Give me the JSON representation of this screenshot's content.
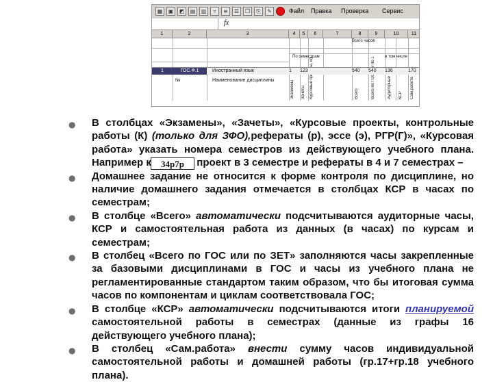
{
  "spreadsheet": {
    "menu": [
      "Файл",
      "Правка",
      "Проверка",
      "Сервис"
    ],
    "formula_label": "fx",
    "column_numbers": [
      "1",
      "2",
      "3",
      "4",
      "5",
      "6",
      "7",
      "8",
      "9",
      "10",
      "11"
    ],
    "group_headers": [
      "По семестрам",
      "Всего часов",
      "в том числе"
    ],
    "name_column_header": "Наименование дисциплины",
    "row_header": "№",
    "rotated_headers": [
      "Экзамены",
      "Зачеты",
      "Курсовые проекты, контрольные работы (К), рефераты (р), эссе (э), РГР(Г)",
      "Всего",
      "Всего по ГОС или по ЗЕТ",
      "Аудиторные",
      "КСР",
      "Сам.работа"
    ],
    "data_row": {
      "num": "1",
      "code": "ГОС.Ф.1",
      "name": "Иностранный язык",
      "exam": "1",
      "credit": "123",
      "total": "540",
      "gos": "540",
      "aud": "136",
      "sr": "170"
    }
  },
  "annotation": "34р7р",
  "bullets": [
    {
      "parts": [
        {
          "t": "В столбцах «Экзамены», «Зачеты», «Курсовые проекты, контрольные работы (К) ",
          "s": "n"
        },
        {
          "t": "(только для ЗФО),",
          "s": "i"
        },
        {
          "t": "рефераты (р), эссе (э), РГР(Г)», «Курсовая работа» указать номера семестров из действующего учебного плана. Например курсовой проект в 3 семестре и рефераты в 4 и 7 семестрах –",
          "s": "n"
        }
      ]
    },
    {
      "parts": [
        {
          "t": "Домашнее задание не относится к форме контроля по дисциплине, но наличие домашнего задания отмечается в столбцах КСР в часах по семестрам;",
          "s": "n"
        }
      ]
    },
    {
      "parts": [
        {
          "t": "В столбце «Всего» ",
          "s": "n"
        },
        {
          "t": "автоматически",
          "s": "i"
        },
        {
          "t": " подсчитываются аудиторные часы, КСР и самостоятельная работа из данных (в часах) по курсам и семестрам;",
          "s": "n"
        }
      ]
    },
    {
      "parts": [
        {
          "t": "В столбец «Всего по ГОС или по ЗЕТ» заполняются часы закрепленные за базовыми дисциплинами в ГОС и часы из учебного плана не регламентированные стандартом таким образом, что бы итоговая сумма часов по компонентам и циклам соответствовала ГОС;",
          "s": "n"
        }
      ]
    },
    {
      "parts": [
        {
          "t": "В столбце «КСР» ",
          "s": "n"
        },
        {
          "t": "автоматически",
          "s": "i"
        },
        {
          "t": " подсчитываются итоги ",
          "s": "n"
        },
        {
          "t": "планируемой",
          "s": "p"
        },
        {
          "t": " самостоятельной работы в семестрах (данные из графы 16 действующего учебного плана);",
          "s": "n"
        }
      ]
    },
    {
      "parts": [
        {
          "t": "В столбец «Сам.работа» ",
          "s": "n"
        },
        {
          "t": "внести",
          "s": "i"
        },
        {
          "t": " сумму часов индивидуальной самостоятельной работы и домашней работы (гр.17+гр.18 учебного плана).",
          "s": "n"
        }
      ]
    }
  ],
  "colors": {
    "accent_blue": "#3333aa",
    "bullet_gray": "#6e6e6e"
  }
}
